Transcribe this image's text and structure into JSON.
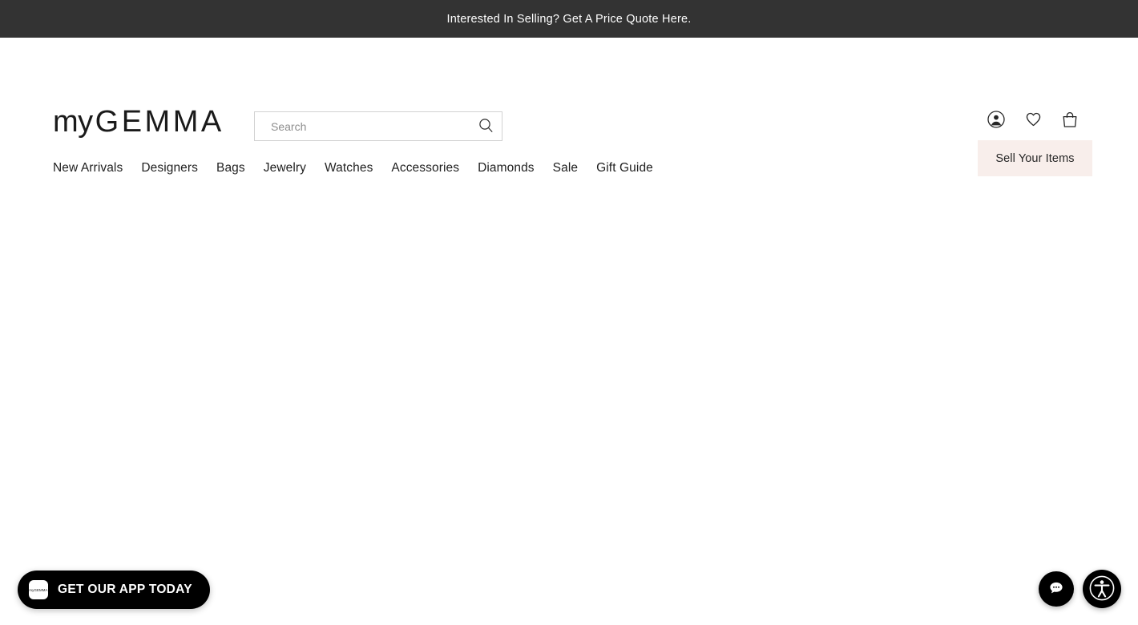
{
  "promo_banner": {
    "text": "Interested In Selling? Get A Price Quote Here.",
    "background_color": "#333333",
    "text_color": "#ffffff"
  },
  "header": {
    "logo": {
      "prefix": "my",
      "wordmark": "GEMMA",
      "full": "myGEMMA"
    },
    "search": {
      "placeholder": "Search",
      "value": "",
      "icon": "search-icon"
    },
    "icons": [
      {
        "name": "account-icon",
        "label": "Account"
      },
      {
        "name": "heart-icon",
        "label": "Wishlist"
      },
      {
        "name": "shopping-bag-icon",
        "label": "Cart"
      }
    ],
    "sell_button": {
      "label": "Sell Your Items",
      "background_color": "#f8eeeb",
      "text_color": "#262626"
    }
  },
  "nav": {
    "items": [
      {
        "label": "New Arrivals"
      },
      {
        "label": "Designers"
      },
      {
        "label": "Bags"
      },
      {
        "label": "Jewelry"
      },
      {
        "label": "Watches"
      },
      {
        "label": "Accessories"
      },
      {
        "label": "Diamonds"
      },
      {
        "label": "Sale"
      },
      {
        "label": "Gift Guide"
      }
    ]
  },
  "main": {
    "content": ""
  },
  "app_banner": {
    "label": "GET OUR APP TODAY",
    "icon_text": "myGEMMA",
    "background_color": "#000000",
    "text_color": "#ffffff"
  },
  "floating_buttons": [
    {
      "name": "chat-button",
      "icon": "chat-bubble-icon",
      "label": "Chat"
    },
    {
      "name": "accessibility-button",
      "icon": "accessibility-icon",
      "label": "Accessibility"
    }
  ]
}
